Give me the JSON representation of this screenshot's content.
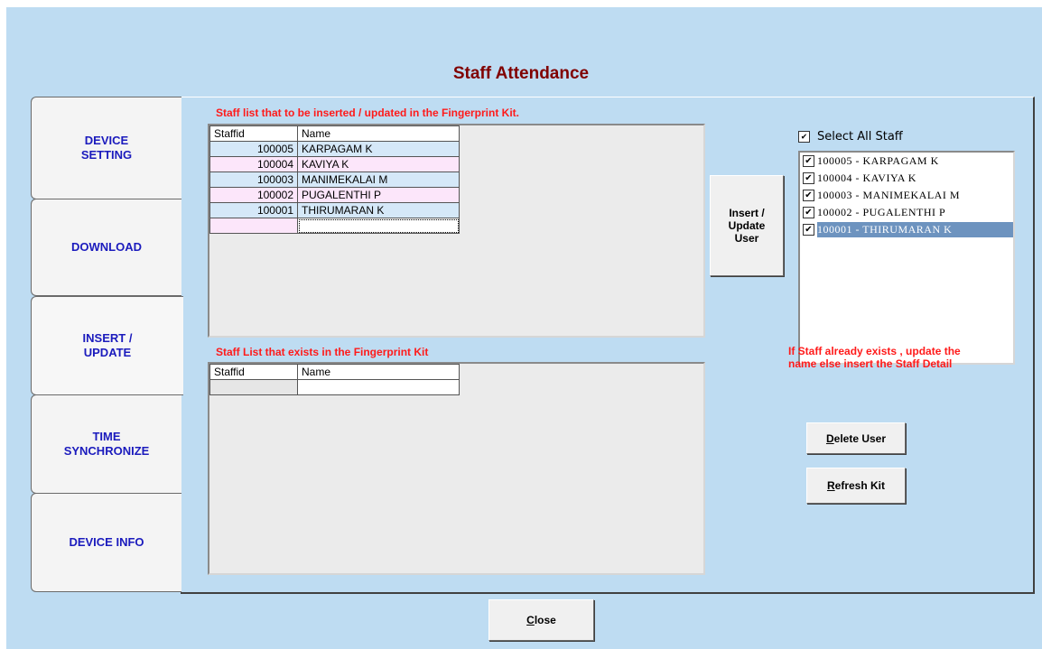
{
  "window": {
    "title": "Staff Attendance"
  },
  "tabs": [
    {
      "label": "DEVICE\nSETTING"
    },
    {
      "label": "DOWNLOAD"
    },
    {
      "label": "INSERT /\nUPDATE"
    },
    {
      "label": "TIME\nSYNCHRONIZE"
    },
    {
      "label": "DEVICE INFO"
    }
  ],
  "top_grid": {
    "label": "Staff list that to be inserted / updated in the Fingerprint Kit.",
    "headers": [
      "Staffid",
      "Name"
    ],
    "rows": [
      {
        "id": "100005",
        "name": "KARPAGAM K"
      },
      {
        "id": "100004",
        "name": "KAVIYA K"
      },
      {
        "id": "100003",
        "name": "MANIMEKALAI M"
      },
      {
        "id": "100002",
        "name": "PUGALENTHI P"
      },
      {
        "id": "100001",
        "name": "THIRUMARAN K"
      }
    ]
  },
  "bottom_grid": {
    "label": "Staff List that exists in the Fingerprint Kit",
    "headers": [
      "Staffid",
      "Name"
    ]
  },
  "buttons": {
    "insert_update": "Insert /\nUpdate\nUser",
    "delete_user": "Delete User",
    "refresh_kit": "Refresh Kit",
    "close": "Close"
  },
  "select_all": {
    "label": "Select All Staff",
    "checked": true
  },
  "staff_list": [
    {
      "text": "100005 - KARPAGAM K",
      "checked": true
    },
    {
      "text": "100004 - KAVIYA K",
      "checked": true
    },
    {
      "text": "100003 - MANIMEKALAI M",
      "checked": true
    },
    {
      "text": "100002 - PUGALENTHI P",
      "checked": true
    },
    {
      "text": "100001 - THIRUMARAN K",
      "checked": true,
      "selected": true
    }
  ],
  "info_note": "If Staff already  exists , update the\nname else insert the Staff Detail",
  "colors": {
    "title": "#800000",
    "tab_text": "#1b1bbd",
    "warning": "#ff1a1a",
    "background": "#bedcf2",
    "selection": "#6d93bf"
  }
}
